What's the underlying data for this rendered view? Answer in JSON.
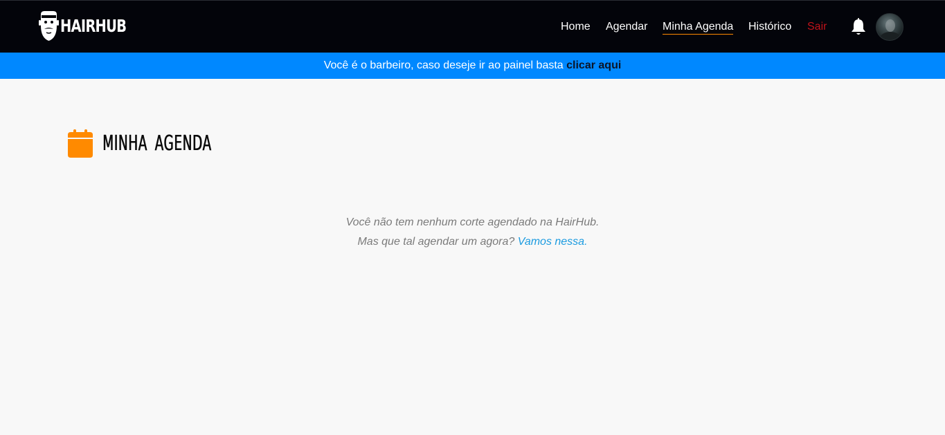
{
  "brand": {
    "name": "HAIRHUB",
    "logo_icon": "bearded-man-icon"
  },
  "nav": {
    "items": [
      {
        "label": "Home"
      },
      {
        "label": "Agendar"
      },
      {
        "label": "Minha Agenda",
        "active": true
      },
      {
        "label": "Histórico"
      },
      {
        "label": "Sair"
      }
    ],
    "notification_icon": "bell-icon",
    "avatar_icon": "user-avatar"
  },
  "banner": {
    "text": "Você é o barbeiro, caso deseje ir ao painel basta ",
    "link": "clicar aqui",
    "color": "#0088ff"
  },
  "page": {
    "title": "MINHA AGENDA",
    "title_icon": "calendar-icon",
    "title_icon_color": "#ff8a00"
  },
  "empty_state": {
    "line1": "Você não tem nenhum corte agendado na HairHub.",
    "line2_prefix": "Mas que tal agendar um agora? ",
    "line2_link": "Vamos nessa."
  },
  "colors": {
    "navbar_bg": "#03040a",
    "accent": "#ff8a00",
    "logout": "#c1121a",
    "link": "#1b9be0"
  }
}
